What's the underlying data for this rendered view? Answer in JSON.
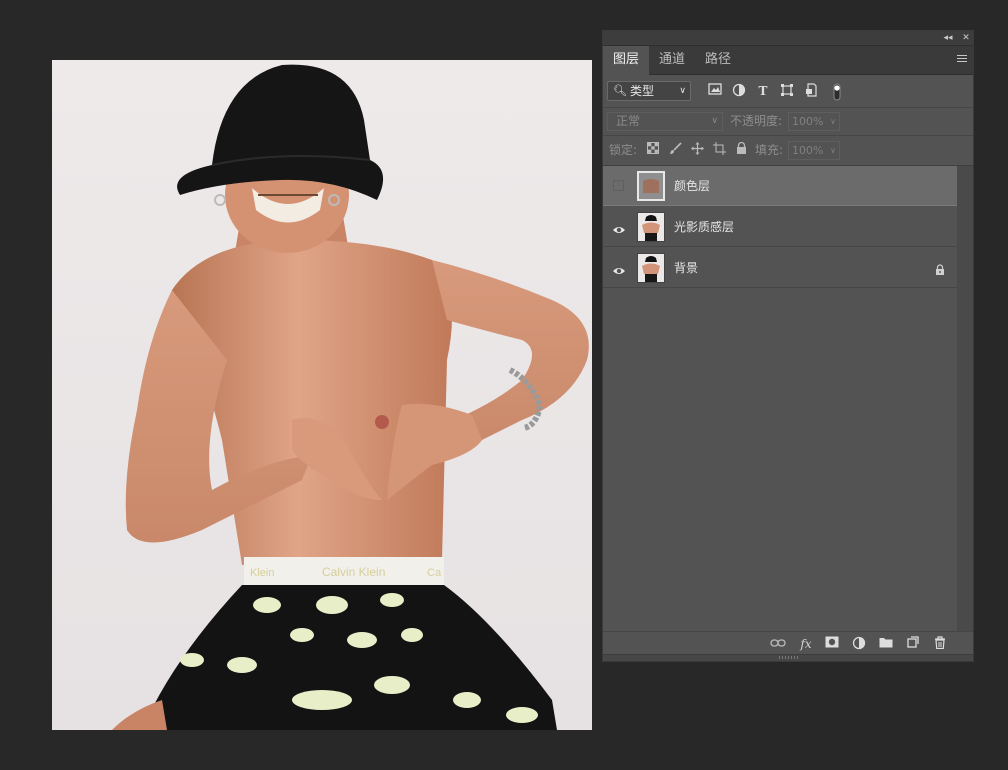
{
  "panel": {
    "collapse_glyph": "◂◂",
    "close_glyph": "✕",
    "tabs": [
      {
        "label": "图层",
        "active": true
      },
      {
        "label": "通道",
        "active": false
      },
      {
        "label": "路径",
        "active": false
      }
    ],
    "filter": {
      "value": "类型",
      "icons": [
        "image-filter-icon",
        "adjustment-filter-icon",
        "type-filter-icon",
        "shape-filter-icon",
        "smart-object-filter-icon",
        "filter-toggle-icon"
      ]
    },
    "blend_mode": "正常",
    "opacity_label": "不透明度:",
    "opacity_value": "100%",
    "lock_label": "锁定:",
    "fill_label": "填充:",
    "fill_value": "100%",
    "layers": [
      {
        "name": "颜色层",
        "visible": false,
        "selected": true,
        "locked": false,
        "thumb": "solid-color",
        "color": "#a0705e"
      },
      {
        "name": "光影质感层",
        "visible": true,
        "selected": false,
        "locked": false,
        "thumb": "photo"
      },
      {
        "name": "背景",
        "visible": true,
        "selected": false,
        "locked": true,
        "thumb": "photo"
      }
    ],
    "bottom_icons": [
      "link-layers-icon",
      "fx-icon",
      "mask-icon",
      "adjustment-layer-icon",
      "group-folder-icon",
      "new-layer-icon",
      "delete-icon"
    ]
  },
  "canvas": {
    "waistband_text": "Calvin Klein",
    "waistband_left_text": "Klein",
    "waistband_right_text": "Ca"
  },
  "colors": {
    "panel_bg": "#535353",
    "selected_row": "#6b6b6b",
    "app_bg": "#282828"
  }
}
